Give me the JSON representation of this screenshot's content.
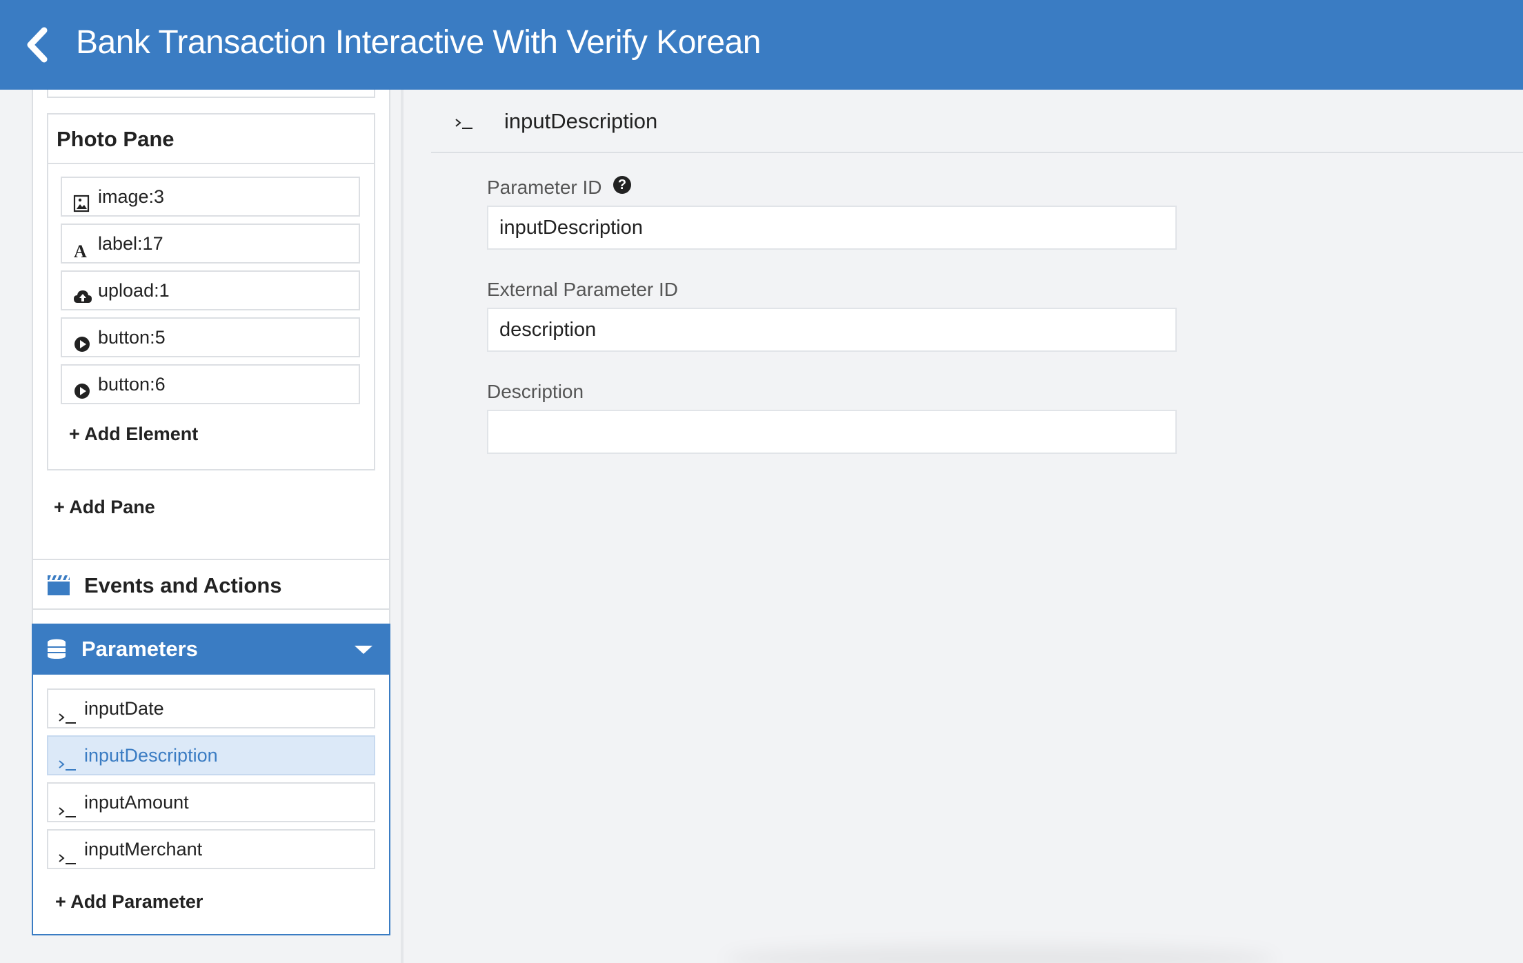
{
  "header": {
    "title": "Bank Transaction Interactive With Verify Korean",
    "back_icon": "chevron-left-icon"
  },
  "sidebar": {
    "pane": {
      "title": "Photo Pane",
      "elements": [
        {
          "label": "image:3",
          "icon": "image-icon"
        },
        {
          "label": "label:17",
          "icon": "text-label-icon"
        },
        {
          "label": "upload:1",
          "icon": "cloud-upload-icon"
        },
        {
          "label": "button:5",
          "icon": "play-circle-icon"
        },
        {
          "label": "button:6",
          "icon": "play-circle-icon"
        }
      ],
      "add_element": "+ Add Element"
    },
    "add_pane": "+ Add Pane",
    "events": {
      "label": "Events and Actions",
      "icon": "clapperboard-icon"
    },
    "parameters": {
      "label": "Parameters",
      "icon": "database-icon",
      "items": [
        {
          "label": "inputDate",
          "active": false
        },
        {
          "label": "inputDescription",
          "active": true
        },
        {
          "label": "inputAmount",
          "active": false
        },
        {
          "label": "inputMerchant",
          "active": false
        }
      ],
      "add_parameter": "+ Add Parameter"
    }
  },
  "main": {
    "title": "inputDescription",
    "fields": {
      "parameter_id": {
        "label": "Parameter ID",
        "value": "inputDescription"
      },
      "external_parameter_id": {
        "label": "External Parameter ID",
        "value": "description"
      },
      "description": {
        "label": "Description",
        "value": ""
      }
    }
  },
  "colors": {
    "accent": "#3a7cc3",
    "active_item_bg": "#dce9f8",
    "background": "#f2f3f5"
  }
}
